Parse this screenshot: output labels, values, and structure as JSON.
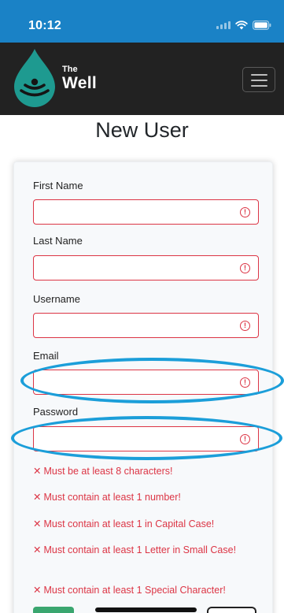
{
  "status_bar": {
    "time": "10:12",
    "background_color": "#1a82c6",
    "icons": [
      "signal-icon",
      "wifi-icon",
      "battery-icon"
    ]
  },
  "navbar": {
    "brand_small": "The",
    "brand_large": "Well",
    "logo_icon": "water-drop-logo-icon",
    "menu_icon": "hamburger-menu-icon",
    "background_color": "#222222"
  },
  "page": {
    "title": "New User"
  },
  "form": {
    "fields": [
      {
        "label": "First Name",
        "value": "",
        "state": "invalid"
      },
      {
        "label": "Last Name",
        "value": "",
        "state": "invalid"
      },
      {
        "label": "Username",
        "value": "",
        "state": "invalid"
      },
      {
        "label": "Email",
        "value": "",
        "state": "invalid"
      },
      {
        "label": "Password",
        "value": "",
        "state": "invalid"
      }
    ],
    "password_rules": [
      {
        "icon": "✕",
        "text": "Must be at least 8 characters!"
      },
      {
        "icon": "✕",
        "text": "Must contain at least 1 number!"
      },
      {
        "icon": "✕",
        "text": "Must contain at least 1 in Capital Case!"
      },
      {
        "icon": "✕",
        "text": "Must contain at least 1 Letter in Small Case!"
      },
      {
        "icon": "✕",
        "text": "Must contain at least 1 Special Character!"
      }
    ],
    "error_color": "#dc3545",
    "annotation_color": "#1b9ed9"
  }
}
